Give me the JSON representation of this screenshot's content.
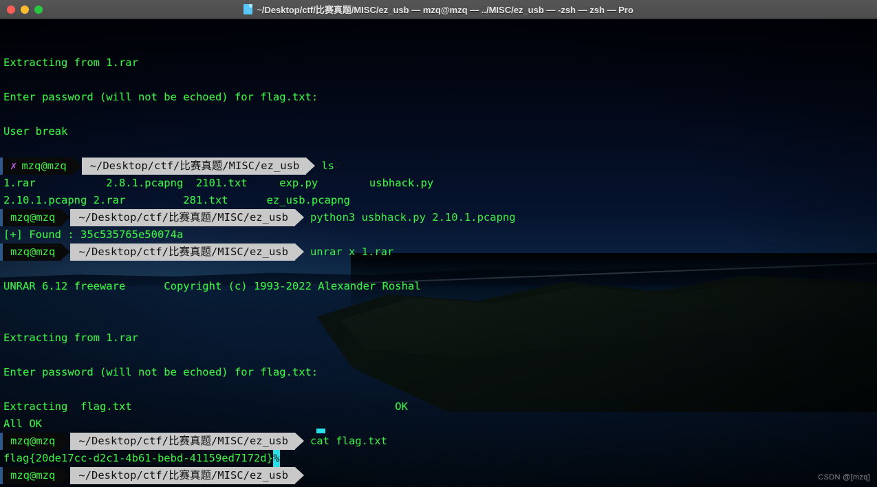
{
  "window": {
    "title": "~/Desktop/ctf/比赛真题/MISC/ez_usb — mzq@mzq — ../MISC/ez_usb — -zsh — zsh — Pro",
    "folder_icon": "folder-icon",
    "controls": {
      "close": "close-button",
      "minimize": "minimize-button",
      "maximize": "maximize-button",
      "close_color": "#ff5f57",
      "minimize_color": "#febc2e",
      "maximize_color": "#28c840"
    }
  },
  "theme": {
    "foreground": "#3ef046",
    "background": "rgba(0,0,0,0.34)",
    "prompt_user_bg": "#0a0a0a",
    "prompt_path_bg": "#c9c9c9",
    "prompt_path_fg": "#111111",
    "error_mark_color": "#c45ef0",
    "cursor_color": "#2ae0e8"
  },
  "prompt": {
    "user": "mzq@mzq",
    "path": "~/Desktop/ctf/比赛真题/MISC/ez_usb",
    "error_mark": "✗"
  },
  "lines": [
    {
      "kind": "blank"
    },
    {
      "kind": "text",
      "text": "Extracting from 1.rar"
    },
    {
      "kind": "blank"
    },
    {
      "kind": "text",
      "text": "Enter password (will not be echoed) for flag.txt:"
    },
    {
      "kind": "blank"
    },
    {
      "kind": "text",
      "text": "User break"
    },
    {
      "kind": "blank"
    },
    {
      "kind": "prompt",
      "error": true,
      "command": "ls"
    },
    {
      "kind": "text",
      "text": "1.rar           2.8.1.pcapng  2101.txt     exp.py        usbhack.py"
    },
    {
      "kind": "text",
      "text": "2.10.1.pcapng 2.rar         281.txt      ez_usb.pcapng"
    },
    {
      "kind": "prompt",
      "error": false,
      "command": "python3 usbhack.py 2.10.1.pcapng"
    },
    {
      "kind": "text",
      "text": "[+] Found : 35c535765e50074a"
    },
    {
      "kind": "prompt",
      "error": false,
      "command": "unrar x 1.rar"
    },
    {
      "kind": "blank"
    },
    {
      "kind": "text",
      "text": "UNRAR 6.12 freeware      Copyright (c) 1993-2022 Alexander Roshal"
    },
    {
      "kind": "blank"
    },
    {
      "kind": "blank"
    },
    {
      "kind": "text",
      "text": "Extracting from 1.rar"
    },
    {
      "kind": "blank"
    },
    {
      "kind": "text",
      "text": "Enter password (will not be echoed) for flag.txt:"
    },
    {
      "kind": "blank"
    },
    {
      "kind": "text",
      "text": "Extracting  flag.txt                                         OK"
    },
    {
      "kind": "text",
      "text": "All OK"
    },
    {
      "kind": "prompt",
      "error": false,
      "command": "cat flag.txt"
    },
    {
      "kind": "flag",
      "text": "flag{20de17cc-d2c1-4b61-bebd-41159ed7172d}",
      "marker": "%"
    },
    {
      "kind": "prompt",
      "error": false,
      "command": ""
    }
  ],
  "output": {
    "extracting_1": "Extracting from 1.rar",
    "password_prompt": "Enter password (will not be echoed) for flag.txt:",
    "user_break": "User break",
    "ls_row_1": "1.rar           2.8.1.pcapng  2101.txt     exp.py        usbhack.py",
    "ls_row_2": "2.10.1.pcapng 2.rar         281.txt      ez_usb.pcapng",
    "found_hash": "[+] Found : 35c535765e50074a",
    "unrar_banner": "UNRAR 6.12 freeware      Copyright (c) 1993-2022 Alexander Roshal",
    "extract_ok": "Extracting  flag.txt                                         OK",
    "all_ok": "All OK",
    "flag": "flag{20de17cc-d2c1-4b61-bebd-41159ed7172d}",
    "zsh_partial_marker": "%"
  },
  "commands": {
    "ls": "ls",
    "usbhack": "python3 usbhack.py 2.10.1.pcapng",
    "unrar": "unrar x 1.rar",
    "cat": "cat flag.txt"
  },
  "files": [
    "1.rar",
    "2.8.1.pcapng",
    "2101.txt",
    "exp.py",
    "usbhack.py",
    "2.10.1.pcapng",
    "2.rar",
    "281.txt",
    "ez_usb.pcapng"
  ],
  "watermark": "CSDN @[mzq]"
}
